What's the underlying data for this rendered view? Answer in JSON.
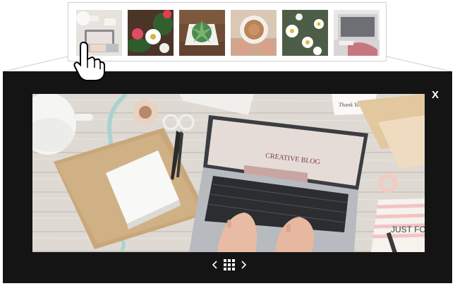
{
  "gallery": {
    "thumbnails": [
      {
        "name": "thumbnail-laptop-desk",
        "icon": "laptop-desk-photo",
        "selected": true
      },
      {
        "name": "thumbnail-flowers",
        "icon": "flowers-photo",
        "selected": false
      },
      {
        "name": "thumbnail-succulent",
        "icon": "succulent-photo",
        "selected": false
      },
      {
        "name": "thumbnail-coffee-cup",
        "icon": "coffee-cup-photo",
        "selected": false
      },
      {
        "name": "thumbnail-daisies",
        "icon": "daisies-photo",
        "selected": false
      },
      {
        "name": "thumbnail-laptop-pink",
        "icon": "laptop-pink-photo",
        "selected": false
      }
    ]
  },
  "lightbox": {
    "close_label": "X",
    "photo": {
      "screen_text": "CREATIVE BLOG",
      "card_text": "Thank You",
      "notebook_text": "JUST FOR"
    },
    "nav": {
      "prev_icon": "chevron-left-icon",
      "grid_icon": "grid-icon",
      "next_icon": "chevron-right-icon"
    }
  },
  "colors": {
    "overlay": "#141414",
    "strip_border": "#cfcfcf"
  }
}
